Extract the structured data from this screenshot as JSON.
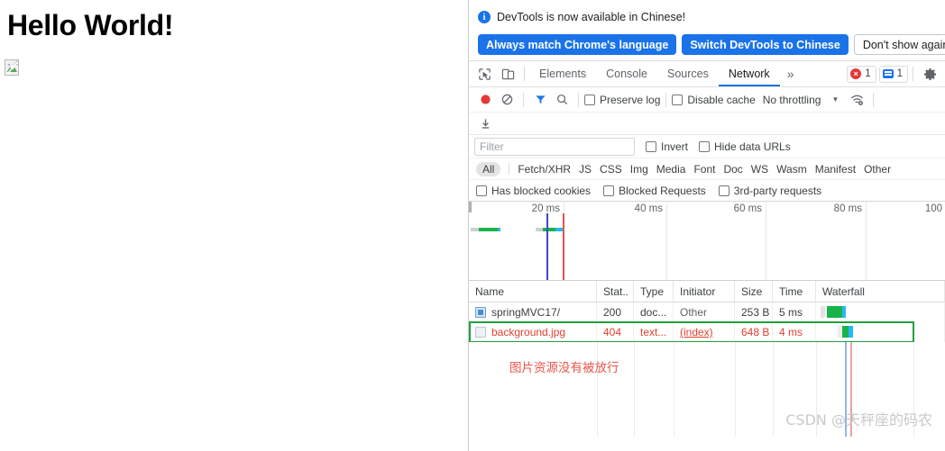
{
  "page": {
    "heading": "Hello World!",
    "broken_image_alt": "broken-image"
  },
  "infobar": {
    "icon": "info-icon",
    "message": "DevTools is now available in Chinese!",
    "primary_button_1": "Always match Chrome's language",
    "primary_button_2": "Switch DevTools to Chinese",
    "secondary_button": "Don't show again"
  },
  "tabbar": {
    "inspect_icon": "inspect-cursor-icon",
    "device_icon": "device-toggle-icon",
    "tabs": [
      {
        "label": "Elements",
        "active": false
      },
      {
        "label": "Console",
        "active": false
      },
      {
        "label": "Sources",
        "active": false
      },
      {
        "label": "Network",
        "active": true
      }
    ],
    "more": "»",
    "error_count": "1",
    "message_count": "1",
    "settings_icon": "gear-icon"
  },
  "network_toolbar": {
    "record_icon": "record-icon",
    "clear_icon": "clear-icon",
    "filter_icon": "filter-icon",
    "search_icon": "search-icon",
    "preserve_log": {
      "label": "Preserve log",
      "checked": false
    },
    "disable_cache": {
      "label": "Disable cache",
      "checked": false
    },
    "throttling": "No throttling",
    "throttling_caret": "▼",
    "network_conditions_icon": "wifi-settings-icon",
    "export_icon": "download-har-icon"
  },
  "filter_bar": {
    "filter_placeholder": "Filter",
    "filter_value": "",
    "invert": {
      "label": "Invert",
      "checked": false
    },
    "hide_data_urls": {
      "label": "Hide data URLs",
      "checked": false
    },
    "types": [
      {
        "label": "All",
        "active": true
      },
      {
        "label": "Fetch/XHR",
        "active": false
      },
      {
        "label": "JS",
        "active": false
      },
      {
        "label": "CSS",
        "active": false
      },
      {
        "label": "Img",
        "active": false
      },
      {
        "label": "Media",
        "active": false
      },
      {
        "label": "Font",
        "active": false
      },
      {
        "label": "Doc",
        "active": false
      },
      {
        "label": "WS",
        "active": false
      },
      {
        "label": "Wasm",
        "active": false
      },
      {
        "label": "Manifest",
        "active": false
      },
      {
        "label": "Other",
        "active": false
      }
    ],
    "has_blocked_cookies": {
      "label": "Has blocked cookies",
      "checked": false
    },
    "blocked_requests": {
      "label": "Blocked Requests",
      "checked": false
    },
    "third_party": {
      "label": "3rd-party requests",
      "checked": false
    }
  },
  "overview": {
    "ticks": [
      "20 ms",
      "40 ms",
      "60 ms",
      "80 ms",
      "100"
    ],
    "dom_content_loaded_color": "#3b48cc",
    "load_color": "#e9544a"
  },
  "requests_table": {
    "columns": [
      "Name",
      "Stat..",
      "Type",
      "Initiator",
      "Size",
      "Time",
      "Waterfall"
    ],
    "rows": [
      {
        "icon": "document-icon",
        "name": "springMVC17/",
        "status": "200",
        "type": "doc...",
        "initiator": "Other",
        "initiator_link": false,
        "size": "253 B",
        "time": "5 ms",
        "error": false,
        "highlighted": false
      },
      {
        "icon": "image-icon",
        "name": "background.jpg",
        "status": "404",
        "type": "text...",
        "initiator": "(index)",
        "initiator_link": true,
        "size": "648 B",
        "time": "4 ms",
        "error": true,
        "highlighted": true
      }
    ]
  },
  "annotation": {
    "text": "图片资源没有被放行",
    "color": "#e8554a"
  },
  "watermark": {
    "text": "CSDN @天秤座的码农"
  },
  "colors": {
    "accent": "#1a73e8",
    "error": "#e2402e",
    "highlight_border": "#21a03f",
    "waterfall_green": "#17b34a",
    "waterfall_blue": "#2196f3"
  }
}
